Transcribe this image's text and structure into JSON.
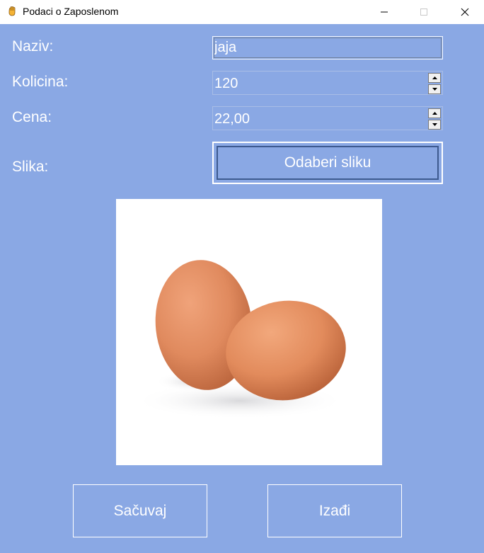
{
  "window": {
    "title": "Podaci o Zaposlenom",
    "icon": "hand-icon"
  },
  "form": {
    "name_label": "Naziv:",
    "name_value": "jaja",
    "quantity_label": "Kolicina:",
    "quantity_value": "120",
    "price_label": "Cena:",
    "price_value": "22,00",
    "image_label": "Slika:",
    "choose_image_button": "Odaberi sliku"
  },
  "picture": {
    "subject": "two brown eggs"
  },
  "actions": {
    "save_label": "Sačuvaj",
    "exit_label": "Izađi"
  },
  "colors": {
    "background": "#8aa8e4",
    "text": "#ffffff"
  }
}
